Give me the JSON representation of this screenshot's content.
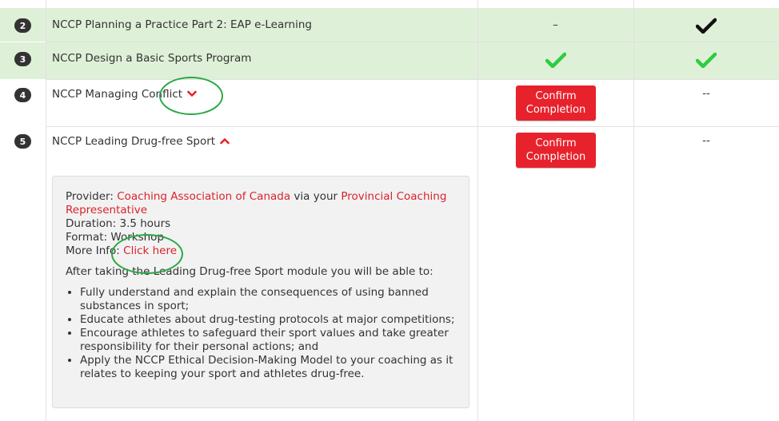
{
  "rows": [
    {
      "number": "2",
      "title": "NCCP Planning a Practice Part 2: EAP e-Learning",
      "col1": "–",
      "col2_icon": "black-check-icon"
    },
    {
      "number": "3",
      "title": "NCCP Design a Basic Sports Program",
      "col1_icon": "green-check-icon",
      "col2_icon": "green-check-icon"
    },
    {
      "number": "4",
      "title": "NCCP Managing Conflict",
      "button": [
        "Confirm",
        "Completion"
      ],
      "col2": "--",
      "chevron": "chevron-down-icon"
    },
    {
      "number": "5",
      "title": "NCCP Leading Drug-free Sport",
      "button": [
        "Confirm",
        "Completion"
      ],
      "col2": "--",
      "chevron": "chevron-up-icon"
    }
  ],
  "details": {
    "provider_label": "Provider: ",
    "provider_link": "Coaching Association of Canada",
    "via_text": " via your ",
    "representative_link": "Provincial Coaching Representative",
    "duration": "Duration: 3.5 hours",
    "format": "Format: Workshop",
    "more_info_label": "More Info: ",
    "more_info_link": "Click here",
    "intro": "After taking the Leading Drug-free Sport module you will be able to:",
    "bullets": [
      "Fully understand and explain the consequences of using banned substances in sport;",
      "Educate athletes about drug-testing protocols at major competitions;",
      "Encourage athletes to safeguard their sport values and take greater responsibility for their personal actions; and",
      "Apply the NCCP Ethical Decision-Making Model to your coaching as it relates to keeping your sport and athletes drug-free."
    ]
  },
  "colors": {
    "green_row": "#dff0d8",
    "button_red": "#e8222c",
    "link_red": "#d9232d",
    "check_green": "#2ecc40",
    "annotation_green": "#2aa845"
  }
}
